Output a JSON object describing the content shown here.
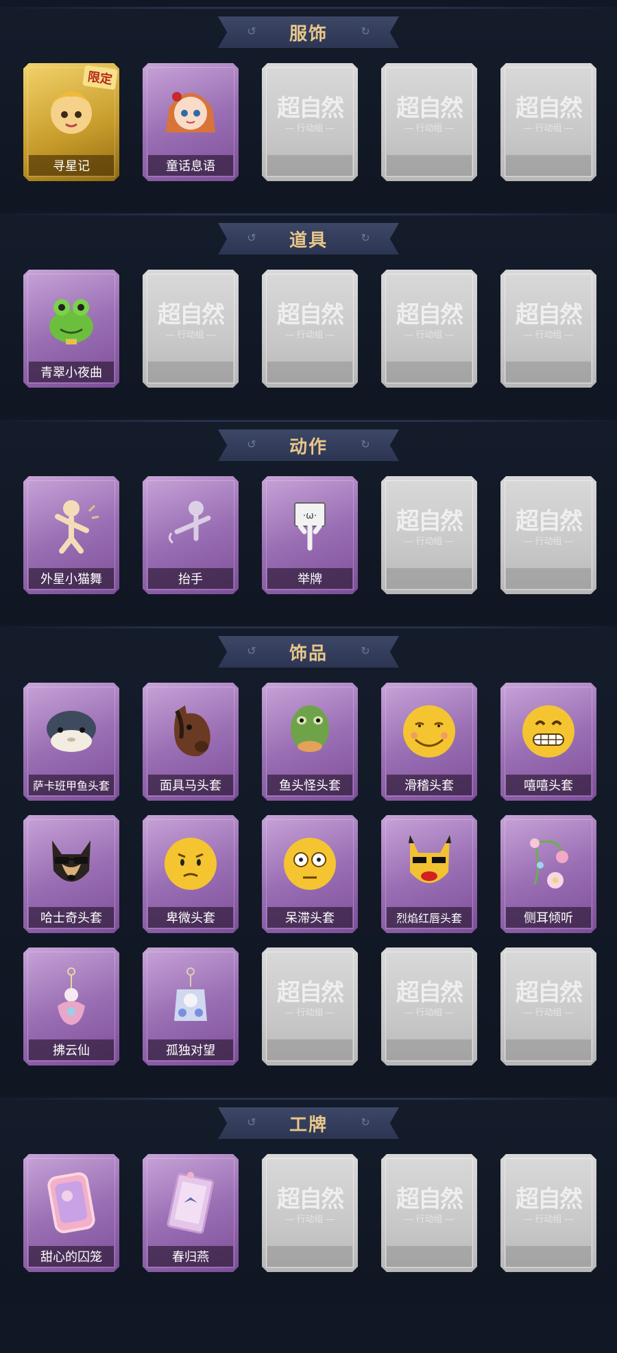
{
  "sections": [
    {
      "title": "服饰",
      "items": [
        {
          "label": "寻星记",
          "locked": false,
          "badge": "限定",
          "art": "blonde-chibi-character-icon",
          "gold": true
        },
        {
          "label": "童话息语",
          "locked": false,
          "art": "redhead-doll-character-icon"
        },
        {
          "label": "",
          "locked": true
        },
        {
          "label": "",
          "locked": true
        },
        {
          "label": "",
          "locked": true
        }
      ]
    },
    {
      "title": "道具",
      "items": [
        {
          "label": "青翠小夜曲",
          "locked": false,
          "art": "green-frog-icon"
        },
        {
          "label": "",
          "locked": true
        },
        {
          "label": "",
          "locked": true
        },
        {
          "label": "",
          "locked": true
        },
        {
          "label": "",
          "locked": true
        }
      ]
    },
    {
      "title": "动作",
      "items": [
        {
          "label": "外星小猫舞",
          "locked": false,
          "art": "dance-pose-icon"
        },
        {
          "label": "抬手",
          "locked": false,
          "art": "raise-hand-icon"
        },
        {
          "label": "举牌",
          "locked": false,
          "art": "hold-sign-icon"
        },
        {
          "label": "",
          "locked": true
        },
        {
          "label": "",
          "locked": true
        }
      ]
    },
    {
      "title": "饰品",
      "items": [
        {
          "label": "萨卡班甲鱼头套",
          "locked": false,
          "art": "fish-head-icon"
        },
        {
          "label": "面具马头套",
          "locked": false,
          "art": "horse-head-icon"
        },
        {
          "label": "鱼头怪头套",
          "locked": false,
          "art": "fish-monster-head-icon"
        },
        {
          "label": "滑稽头套",
          "locked": false,
          "art": "funny-smiley-icon"
        },
        {
          "label": "嘻嘻头套",
          "locked": false,
          "art": "grin-smiley-icon"
        },
        {
          "label": "哈士奇头套",
          "locked": false,
          "art": "husky-head-icon"
        },
        {
          "label": "卑微头套",
          "locked": false,
          "art": "humble-smiley-icon"
        },
        {
          "label": "呆滞头套",
          "locked": false,
          "art": "dazed-smiley-icon"
        },
        {
          "label": "烈焰红唇头套",
          "locked": false,
          "art": "pikachu-lips-head-icon"
        },
        {
          "label": "侧耳倾听",
          "locked": false,
          "art": "flower-earring-icon"
        },
        {
          "label": "拂云仙",
          "locked": false,
          "art": "cloud-fairy-charm-icon"
        },
        {
          "label": "孤独对望",
          "locked": false,
          "art": "lonely-gaze-charm-icon"
        },
        {
          "label": "",
          "locked": true
        },
        {
          "label": "",
          "locked": true
        },
        {
          "label": "",
          "locked": true
        }
      ]
    },
    {
      "title": "工牌",
      "items": [
        {
          "label": "甜心的囚笼",
          "locked": false,
          "art": "pink-mirror-badge-icon"
        },
        {
          "label": "春归燕",
          "locked": false,
          "art": "spring-swallow-badge-icon"
        },
        {
          "label": "",
          "locked": true
        },
        {
          "label": "",
          "locked": true
        },
        {
          "label": "",
          "locked": true
        }
      ]
    }
  ],
  "locked_watermark": {
    "title": "超自然",
    "subtitle": "行动组"
  },
  "colors": {
    "background": "#111724",
    "banner": "#3d4766",
    "title": "#e8c78a",
    "card_unlocked": "#9a6fb4",
    "card_locked": "#c8c8c8",
    "card_gold": "#c69a2a"
  }
}
